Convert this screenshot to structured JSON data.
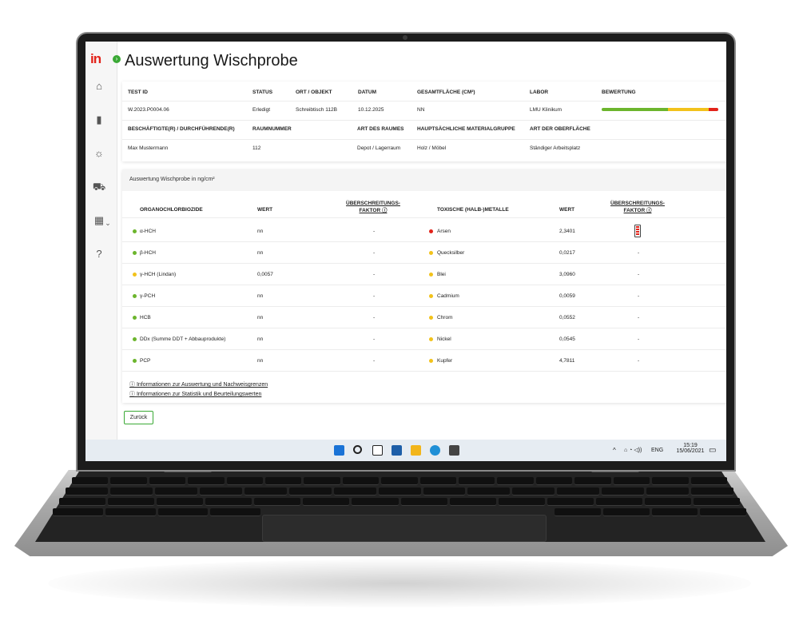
{
  "app": {
    "logo_text": "in",
    "expand_symbol": "›",
    "title": "Auswertung Wischprobe"
  },
  "sidebar": {
    "items": [
      {
        "icon": "home-icon",
        "glyph": "⌂"
      },
      {
        "icon": "chart-icon",
        "glyph": "▮"
      },
      {
        "icon": "lightbulb-icon",
        "glyph": "☼"
      },
      {
        "icon": "cart-icon",
        "glyph": "⛟"
      },
      {
        "icon": "building-icon",
        "glyph": "▦"
      },
      {
        "icon": "help-icon",
        "glyph": "?"
      }
    ],
    "dropdown_symbol": "⌄"
  },
  "summary": {
    "headers_row1": [
      "TEST ID",
      "STATUS",
      "ORT / OBJEKT",
      "DATUM",
      "GESAMTFLÄCHE (CM²)",
      "LABOR",
      "BEWERTUNG"
    ],
    "values_row1": [
      "W.2023.P0004.06",
      "Erledigt",
      "Schreibtisch 112B",
      "10.12.2025",
      "NN",
      "LMU Klinikum"
    ],
    "headers_row2": [
      "BESCHÄFTIGTE(R) / DURCHFÜHRENDE(R)",
      "RAUMNUMMER",
      "ART DES RAUMES",
      "HAUPTSÄCHLICHE MATERIALGRUPPE",
      "ART DER OBERFLÄCHE"
    ],
    "values_row2": [
      "Max Mustermann",
      "112",
      "Depot / Lagerraum",
      "Holz / Möbel",
      "Ständiger Arbeitsplatz"
    ],
    "rating_colors": [
      "#6cb52d",
      "#f2c21b",
      "#e2231a"
    ],
    "rating_fractions": [
      0.57,
      0.35,
      0.08
    ]
  },
  "results": {
    "section_title": "Auswertung Wischprobe in ng/cm²",
    "left_headers": {
      "name": "ORGANOCHLORBIOZIDE",
      "value": "WERT",
      "factor_line1": "ÜBERSCHREITUNGS-",
      "factor_line2": "FAKTOR ⓘ"
    },
    "right_headers": {
      "name": "TOXISCHE (HALB-)METALLE",
      "value": "WERT",
      "factor_line1": "ÜBERSCHREITUNGS-",
      "factor_line2": "FAKTOR ⓘ"
    },
    "left_rows": [
      {
        "name": "α-HCH",
        "value": "nn",
        "factor": "-",
        "status": "green"
      },
      {
        "name": "β-HCH",
        "value": "nn",
        "factor": "-",
        "status": "green"
      },
      {
        "name": "γ-HCH (Lindan)",
        "value": "0,0057",
        "factor": "-",
        "status": "yellow"
      },
      {
        "name": "γ-PCH",
        "value": "nn",
        "factor": "-",
        "status": "green"
      },
      {
        "name": "HCB",
        "value": "nn",
        "factor": "-",
        "status": "green"
      },
      {
        "name": "DDx (Summe DDT + Abbauprodukte)",
        "value": "nn",
        "factor": "-",
        "status": "green"
      },
      {
        "name": "PCP",
        "value": "nn",
        "factor": "-",
        "status": "green"
      }
    ],
    "right_rows": [
      {
        "name": "Arsen",
        "value": "2,3401",
        "factor": "",
        "status": "red"
      },
      {
        "name": "Quecksilber",
        "value": "0,0217",
        "factor": "-",
        "status": "yellow"
      },
      {
        "name": "Blei",
        "value": "3,0960",
        "factor": "-",
        "status": "yellow"
      },
      {
        "name": "Cadmium",
        "value": "0,0059",
        "factor": "-",
        "status": "yellow"
      },
      {
        "name": "Chrom",
        "value": "0,0552",
        "factor": "-",
        "status": "yellow"
      },
      {
        "name": "Nickel",
        "value": "0,0545",
        "factor": "-",
        "status": "yellow"
      },
      {
        "name": "Kupfer",
        "value": "4,7811",
        "factor": "-",
        "status": "yellow"
      }
    ],
    "status_colors": {
      "green": "#6cb52d",
      "yellow": "#f2c21b",
      "red": "#e2231a"
    },
    "links": [
      "ⓘ Informationen zur Auswertung und Nachweisgrenzen",
      "ⓘ Informationen zur Statistik und Beurteilungswerten"
    ],
    "back_label": "Zurück"
  },
  "taskbar": {
    "icons": [
      "windows-start-icon",
      "search-icon",
      "task-view-icon",
      "widgets-icon",
      "file-explorer-icon",
      "edge-browser-icon",
      "store-icon"
    ],
    "tray_chevron": "^",
    "tray_symbols": "⌂ ◔ ◁))",
    "language": "ENG",
    "time": "15:19",
    "date": "15/06/2021",
    "notification_glyph": "▭"
  }
}
